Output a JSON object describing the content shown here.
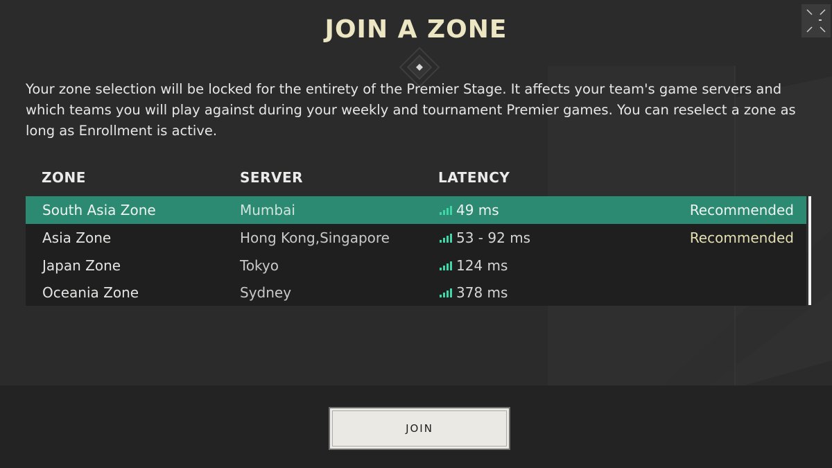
{
  "dialog": {
    "title": "JOIN A ZONE",
    "description": "Your zone selection will be locked for the entirety of the Premier Stage. It affects your team's game servers and which teams you will play against during your weekly and tournament Premier games. You can reselect a zone as long as Enrollment is active."
  },
  "table": {
    "headers": {
      "zone": "ZONE",
      "server": "SERVER",
      "latency": "LATENCY"
    },
    "rows": [
      {
        "zone": "South Asia Zone",
        "server": "Mumbai",
        "latency": "49 ms",
        "tag": "Recommended",
        "selected": true
      },
      {
        "zone": "Asia Zone",
        "server": "Hong Kong,Singapore",
        "latency": "53 - 92 ms",
        "tag": "Recommended",
        "selected": false
      },
      {
        "zone": "Japan Zone",
        "server": "Tokyo",
        "latency": "124 ms",
        "tag": "",
        "selected": false
      },
      {
        "zone": "Oceania Zone",
        "server": "Sydney",
        "latency": "378 ms",
        "tag": "",
        "selected": false
      }
    ]
  },
  "actions": {
    "join_label": "JOIN"
  },
  "icons": {
    "corner": "expand-icon",
    "signal": "signal-strength-icon",
    "emblem": "diamond-emblem-icon"
  },
  "colors": {
    "title": "#ece6c3",
    "selected_row": "#2d8a72",
    "signal": "#3fd6a8",
    "recommended": "#e6dfb3"
  }
}
